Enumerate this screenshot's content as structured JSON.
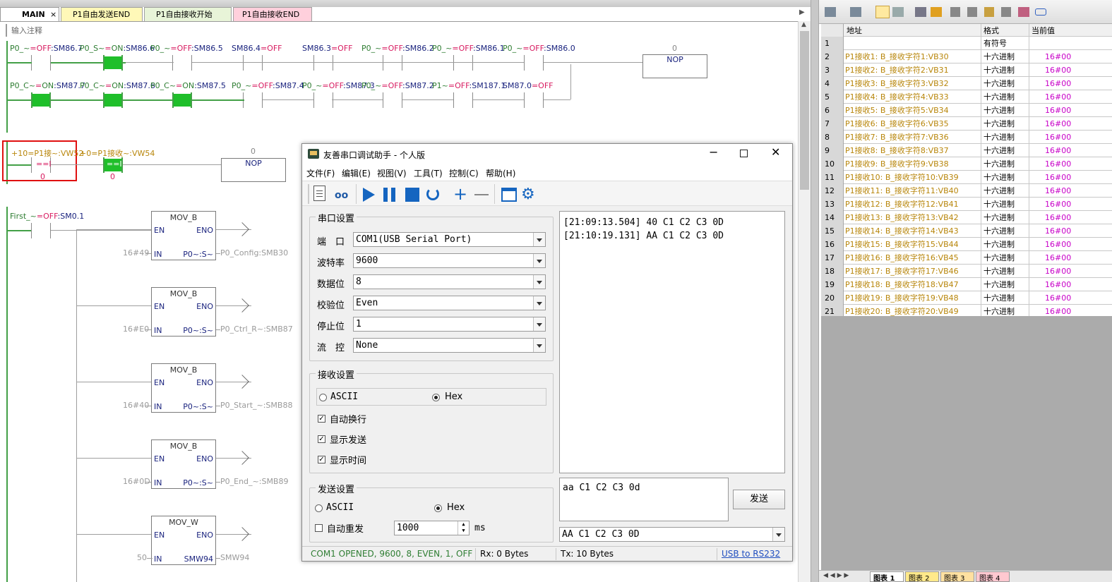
{
  "tabs": [
    {
      "label": "MAIN",
      "close": "×"
    },
    {
      "label": "P1自由发送END"
    },
    {
      "label": "P1自由接收开始"
    },
    {
      "label": "P1自由接收END"
    }
  ],
  "editor": {
    "comment_placeholder": "输入注释",
    "rung1": {
      "contacts": [
        {
          "name": "P0_~",
          "state": "OFF",
          "addr": "SM86.7"
        },
        {
          "name": "P0_S~",
          "state": "ON",
          "addr": "SM86.6"
        },
        {
          "name": "P0_~",
          "state": "OFF",
          "addr": "SM86.5"
        },
        {
          "name": "",
          "state": "",
          "addr": "SM86.4=OFF"
        },
        {
          "name": "",
          "state": "",
          "addr": "SM86.3=OFF"
        },
        {
          "name": "P0_~",
          "state": "OFF",
          "addr": "SM86.2"
        },
        {
          "name": "P0_~",
          "state": "OFF",
          "addr": "SM86.1"
        },
        {
          "name": "P0_~",
          "state": "OFF",
          "addr": "SM86.0"
        }
      ],
      "nop_value": "0",
      "nop_label": "NOP"
    },
    "rung1b": {
      "contacts": [
        {
          "name": "P0_C~",
          "state": "ON",
          "addr": "SM87.7"
        },
        {
          "name": "P0_C~",
          "state": "ON",
          "addr": "SM87.6"
        },
        {
          "name": "P0_C~",
          "state": "ON",
          "addr": "SM87.5"
        },
        {
          "name": "P0_~",
          "state": "OFF",
          "addr": "SM87.4"
        },
        {
          "name": "P0_~",
          "state": "OFF",
          "addr": "SM87.3"
        },
        {
          "name": "P0_~",
          "state": "OFF",
          "addr": "SM87.2"
        },
        {
          "name": "P1~",
          "state": "OFF",
          "addr": "SM187.1"
        },
        {
          "name": "",
          "state": "",
          "addr": "SM87.0=OFF"
        }
      ]
    },
    "rung2": {
      "c1_top": "+10=P1接~:VW52",
      "c1_op": "==I",
      "c1_bottom": "0",
      "c2_top": "+0=P1接收~:VW54",
      "c2_op": "==I",
      "c2_bottom": "0",
      "nop_value": "0",
      "nop_label": "NOP"
    },
    "rung3": {
      "first_label": "First_~",
      "first_state": "OFF",
      "first_addr": "SM0.1",
      "blocks": [
        {
          "title": "MOV_B",
          "en": "EN",
          "eno": "ENO",
          "in": "IN",
          "out": "P0~:S~",
          "in_val": "16#49",
          "out_dest": "P0_Config:SMB30"
        },
        {
          "title": "MOV_B",
          "en": "EN",
          "eno": "ENO",
          "in": "IN",
          "out": "P0~:S~",
          "in_val": "16#E0",
          "out_dest": "P0_Ctrl_R~:SMB87"
        },
        {
          "title": "MOV_B",
          "en": "EN",
          "eno": "ENO",
          "in": "IN",
          "out": "P0~:S~",
          "in_val": "16#40",
          "out_dest": "P0_Start_~:SMB88"
        },
        {
          "title": "MOV_B",
          "en": "EN",
          "eno": "ENO",
          "in": "IN",
          "out": "P0~:S~",
          "in_val": "16#0D",
          "out_dest": "P0_End_~:SMB89"
        },
        {
          "title": "MOV_W",
          "en": "EN",
          "eno": "ENO",
          "in": "IN",
          "out": "SMW94",
          "in_val": "50",
          "out_dest": "SMW94"
        }
      ]
    }
  },
  "watch": {
    "headers": {
      "addr": "地址",
      "fmt": "格式",
      "val": "当前值"
    },
    "row1_fmt": "有符号",
    "rows": [
      {
        "no": "2",
        "addr": "P1接收1: B_接收字符1:VB30",
        "fmt": "十六进制",
        "val": "16#00"
      },
      {
        "no": "3",
        "addr": "P1接收2: B_接收字符2:VB31",
        "fmt": "十六进制",
        "val": "16#00"
      },
      {
        "no": "4",
        "addr": "P1接收3: B_接收字符3:VB32",
        "fmt": "十六进制",
        "val": "16#00"
      },
      {
        "no": "5",
        "addr": "P1接收4: B_接收字符4:VB33",
        "fmt": "十六进制",
        "val": "16#00"
      },
      {
        "no": "6",
        "addr": "P1接收5: B_接收字符5:VB34",
        "fmt": "十六进制",
        "val": "16#00"
      },
      {
        "no": "7",
        "addr": "P1接收6: B_接收字符6:VB35",
        "fmt": "十六进制",
        "val": "16#00"
      },
      {
        "no": "8",
        "addr": "P1接收7: B_接收字符7:VB36",
        "fmt": "十六进制",
        "val": "16#00"
      },
      {
        "no": "9",
        "addr": "P1接收8: B_接收字符8:VB37",
        "fmt": "十六进制",
        "val": "16#00"
      },
      {
        "no": "10",
        "addr": "P1接收9: B_接收字符9:VB38",
        "fmt": "十六进制",
        "val": "16#00"
      },
      {
        "no": "11",
        "addr": "P1接收10: B_接收字符10:VB39",
        "fmt": "十六进制",
        "val": "16#00"
      },
      {
        "no": "12",
        "addr": "P1接收11: B_接收字符11:VB40",
        "fmt": "十六进制",
        "val": "16#00"
      },
      {
        "no": "13",
        "addr": "P1接收12: B_接收字符12:VB41",
        "fmt": "十六进制",
        "val": "16#00"
      },
      {
        "no": "14",
        "addr": "P1接收13: B_接收字符13:VB42",
        "fmt": "十六进制",
        "val": "16#00"
      },
      {
        "no": "15",
        "addr": "P1接收14: B_接收字符14:VB43",
        "fmt": "十六进制",
        "val": "16#00"
      },
      {
        "no": "16",
        "addr": "P1接收15: B_接收字符15:VB44",
        "fmt": "十六进制",
        "val": "16#00"
      },
      {
        "no": "17",
        "addr": "P1接收16: B_接收字符16:VB45",
        "fmt": "十六进制",
        "val": "16#00"
      },
      {
        "no": "18",
        "addr": "P1接收17: B_接收字符17:VB46",
        "fmt": "十六进制",
        "val": "16#00"
      },
      {
        "no": "19",
        "addr": "P1接收18: B_接收字符18:VB47",
        "fmt": "十六进制",
        "val": "16#00"
      },
      {
        "no": "20",
        "addr": "P1接收19: B_接收字符19:VB48",
        "fmt": "十六进制",
        "val": "16#00"
      },
      {
        "no": "21",
        "addr": "P1接收20: B_接收字符20:VB49",
        "fmt": "十六进制",
        "val": "16#00"
      }
    ],
    "bottom_tabs": [
      "图表 1",
      "图表 2",
      "图表 3",
      "图表 4"
    ]
  },
  "dialog": {
    "title": "友善串口调试助手 - 个人版",
    "menus": [
      "文件(F)",
      "编辑(E)",
      "视图(V)",
      "工具(T)",
      "控制(C)",
      "帮助(H)"
    ],
    "serial": {
      "group": "串口设置",
      "port_label": "端　口",
      "port": "COM1(USB Serial Port)",
      "baud_label": "波特率",
      "baud": "9600",
      "data_label": "数据位",
      "data": "8",
      "parity_label": "校验位",
      "parity": "Even",
      "stop_label": "停止位",
      "stop": "1",
      "flow_label": "流　控",
      "flow": "None"
    },
    "receive": {
      "group": "接收设置",
      "ascii": "ASCII",
      "hex": "Hex",
      "auto_newline": "自动换行",
      "show_send": "显示发送",
      "show_time": "显示时间"
    },
    "send": {
      "group": "发送设置",
      "ascii": "ASCII",
      "hex": "Hex",
      "auto_repeat": "自动重发",
      "interval": "1000",
      "unit": "ms",
      "text": "aa C1 C2 C3 0d",
      "button": "发送",
      "history": "AA C1 C2 C3 0D"
    },
    "log": [
      "[21:09:13.504] 40 C1 C2 C3 0D",
      "[21:10:19.131] AA C1 C2 C3 0D"
    ],
    "status": {
      "state": "COM1 OPENED, 9600, 8, EVEN, 1, OFF",
      "rx": "Rx: 0 Bytes",
      "tx": "Tx: 10 Bytes",
      "link": "USB to RS232"
    }
  },
  "colors": {
    "on": "#2e7d32",
    "off": "#d81b60",
    "energized": "#1fbf2a",
    "hex_value": "#c800c8",
    "address": "#b8860b"
  }
}
